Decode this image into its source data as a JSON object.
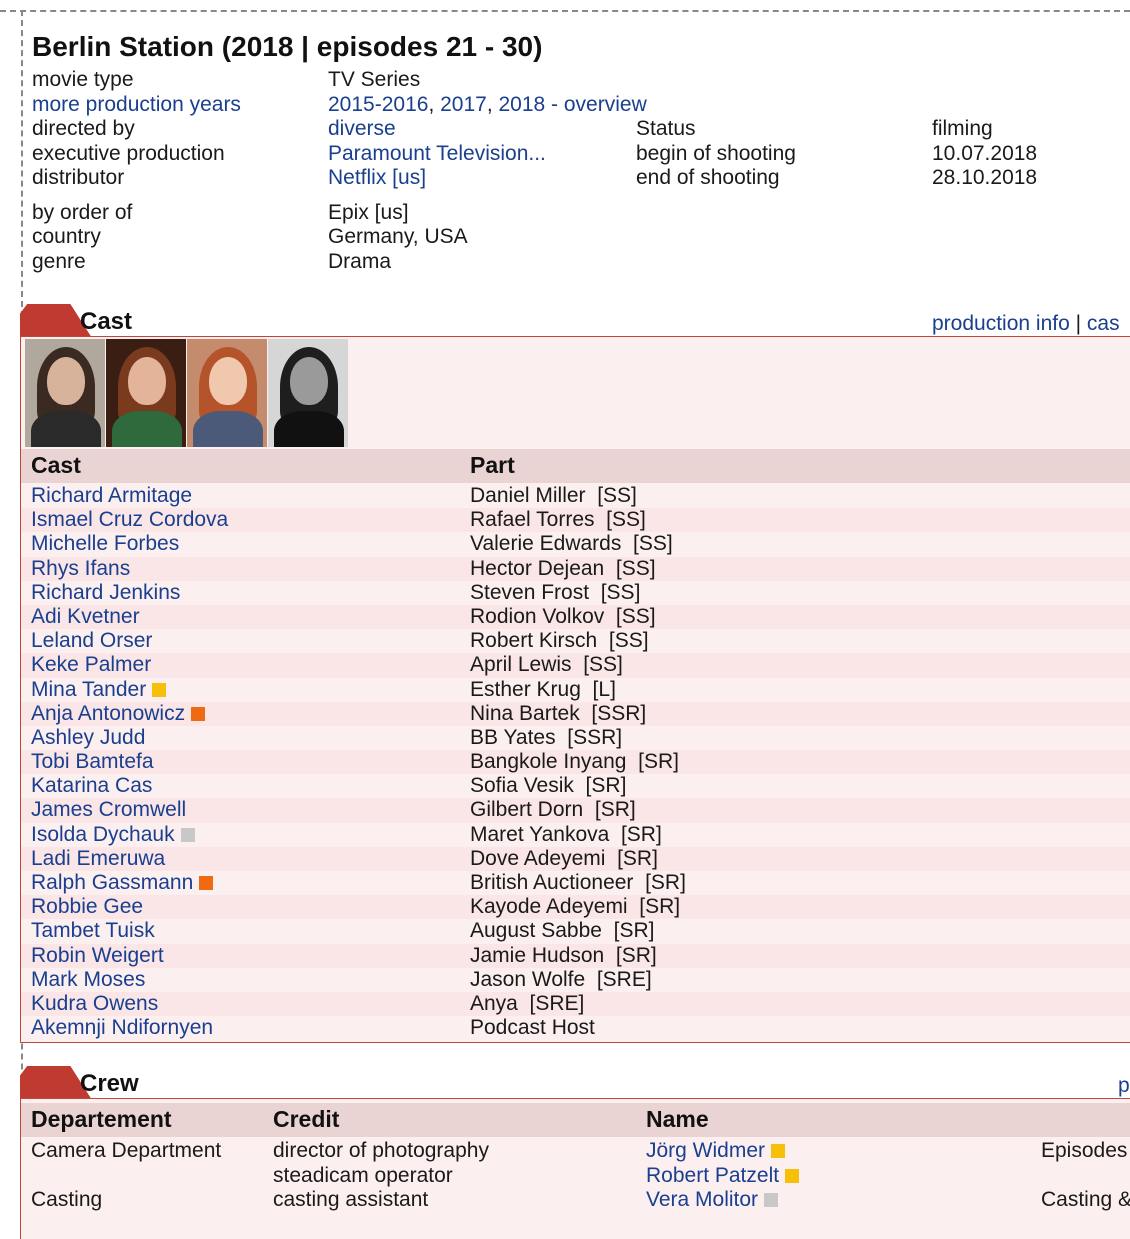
{
  "title": "Berlin Station (2018 | episodes 21 - 30)",
  "info_left": {
    "labels": [
      "movie type",
      "more production years",
      "directed by",
      "executive production",
      "distributor",
      "by order of",
      "country",
      "genre"
    ],
    "movie_type": "TV Series",
    "production_years": [
      "2015-2016",
      "2017",
      "2018 - overview"
    ],
    "directed_by": "diverse",
    "executive_production": "Paramount Television...",
    "distributor": "Netflix [us]",
    "by_order_of": "Epix [us]",
    "country": "Germany, USA",
    "genre": "Drama"
  },
  "info_status": {
    "labels": [
      "Status",
      "begin of shooting",
      "end of shooting"
    ],
    "values": [
      "filming",
      "10.07.2018",
      "28.10.2018"
    ]
  },
  "cast_section": {
    "title": "Cast",
    "links": [
      "production info",
      "cas"
    ],
    "separator": "|",
    "col_cast": "Cast",
    "col_part": "Part",
    "rows": [
      {
        "name": "Richard Armitage",
        "part": "Daniel Miller  [SS]",
        "mark": ""
      },
      {
        "name": "Ismael Cruz Cordova",
        "part": "Rafael Torres  [SS]",
        "mark": ""
      },
      {
        "name": "Michelle Forbes",
        "part": "Valerie Edwards  [SS]",
        "mark": ""
      },
      {
        "name": "Rhys Ifans",
        "part": "Hector Dejean  [SS]",
        "mark": ""
      },
      {
        "name": "Richard Jenkins",
        "part": "Steven Frost  [SS]",
        "mark": ""
      },
      {
        "name": "Adi Kvetner",
        "part": "Rodion Volkov  [SS]",
        "mark": ""
      },
      {
        "name": "Leland Orser",
        "part": "Robert Kirsch  [SS]",
        "mark": ""
      },
      {
        "name": "Keke Palmer",
        "part": "April Lewis  [SS]",
        "mark": ""
      },
      {
        "name": "Mina Tander",
        "part": "Esther Krug  [L]",
        "mark": "#f5bf0a"
      },
      {
        "name": "Anja Antonowicz",
        "part": "Nina Bartek  [SSR]",
        "mark": "#f06a12"
      },
      {
        "name": "Ashley Judd",
        "part": "BB Yates  [SSR]",
        "mark": ""
      },
      {
        "name": "Tobi Bamtefa",
        "part": "Bangkole Inyang  [SR]",
        "mark": ""
      },
      {
        "name": "Katarina Cas",
        "part": "Sofia Vesik  [SR]",
        "mark": ""
      },
      {
        "name": "James Cromwell",
        "part": "Gilbert Dorn  [SR]",
        "mark": ""
      },
      {
        "name": "Isolda Dychauk",
        "part": "Maret Yankova  [SR]",
        "mark": "#c8c8c8"
      },
      {
        "name": "Ladi Emeruwa",
        "part": "Dove Adeyemi  [SR]",
        "mark": ""
      },
      {
        "name": "Ralph Gassmann",
        "part": "British Auctioneer  [SR]",
        "mark": "#f06a12"
      },
      {
        "name": "Robbie Gee",
        "part": "Kayode Adeyemi  [SR]",
        "mark": ""
      },
      {
        "name": "Tambet Tuisk",
        "part": "August Sabbe  [SR]",
        "mark": ""
      },
      {
        "name": "Robin Weigert",
        "part": "Jamie Hudson  [SR]",
        "mark": ""
      },
      {
        "name": "Mark Moses",
        "part": "Jason Wolfe  [SRE]",
        "mark": ""
      },
      {
        "name": "Kudra Owens",
        "part": "Anya  [SRE]",
        "mark": ""
      },
      {
        "name": "Akemnji Ndifornyen",
        "part": "Podcast Host",
        "mark": ""
      }
    ]
  },
  "crew_section": {
    "title": "Crew",
    "link": "p",
    "col_departement": "Departement",
    "col_credit": "Credit",
    "col_name": "Name",
    "rows": [
      {
        "dept": "Camera Department",
        "credit": "director of photography",
        "name": "Jörg Widmer",
        "mark": "#f5bf0a",
        "extra": "Episodes"
      },
      {
        "dept": "",
        "credit": "steadicam operator",
        "name": "Robert Patzelt",
        "mark": "#f5bf0a",
        "extra": ""
      },
      {
        "dept": "Casting",
        "credit": "casting assistant",
        "name": "Vera Molitor",
        "mark": "#c8c8c8",
        "extra": "Casting &"
      }
    ]
  },
  "colors": {
    "link": "#1a3f8f",
    "section_tab": "#bf3a30",
    "panel_border": "#c0463d",
    "panel_bg": "#fcefef",
    "header_bg": "#ead3d3"
  }
}
